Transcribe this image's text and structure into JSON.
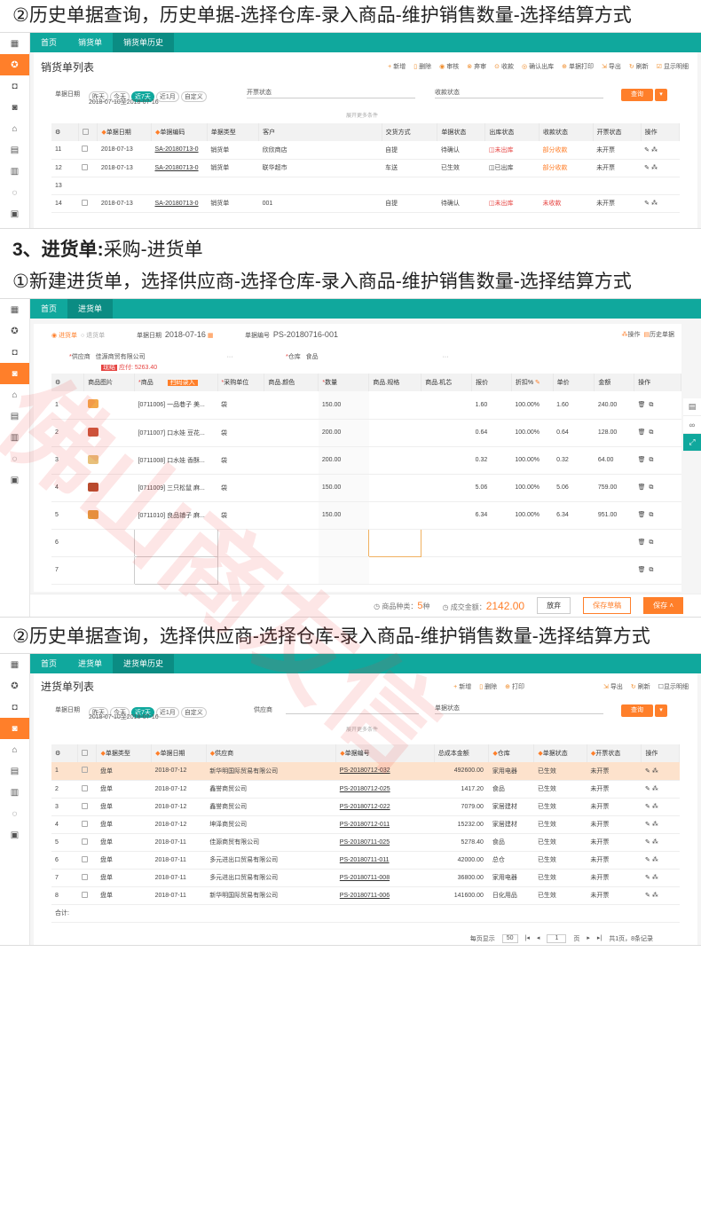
{
  "h1": "②历史单据查询，历史单据-选择仓库-录入商品-维护销售数量-选择结算方式",
  "h2_bold": "3、进货单:",
  "h2_rest": "采购-进货单",
  "h3": "①新建进货单，选择供应商-选择仓库-录入商品-维护销售数量-选择结算方式",
  "h4": "②历史单据查询，选择供应商-选择仓库-录入商品-维护销售数量-选择结算方式",
  "s1": {
    "tabs": [
      "首页",
      "销货单",
      "销货单历史"
    ],
    "title": "销货单列表",
    "toolbar": [
      "新增",
      "删除",
      "审核",
      "弃审",
      "收款",
      "确认出库",
      "单据打印",
      "导出",
      "刷新",
      "显示明细"
    ],
    "date_label": "单据日期",
    "chips": [
      "昨天",
      "今天",
      "近7天",
      "近1月",
      "自定义"
    ],
    "date_range": "2018-07-10至2018-07-16",
    "f2": "开票状态",
    "f3": "收款状态",
    "query": "查询",
    "more": "展开更多条件",
    "headers": [
      "",
      "",
      "单据日期",
      "单据编码",
      "单据类型",
      "客户",
      "交货方式",
      "单据状态",
      "出库状态",
      "收款状态",
      "开票状态",
      "操作"
    ],
    "rows": [
      {
        "n": "11",
        "d": "2018-07-13",
        "c": "SA-20180713-0",
        "t": "销货单",
        "cu": "欣欣商店",
        "m": "自提",
        "s": "待确认",
        "o": "未出库",
        "p": "部分收款",
        "i": "未开票"
      },
      {
        "n": "12",
        "d": "2018-07-13",
        "c": "SA-20180713-0",
        "t": "销货单",
        "cu": "联华超市",
        "m": "车送",
        "s": "已生效",
        "o": "已出库",
        "p": "部分收款",
        "i": "未开票"
      },
      {
        "n": "13",
        "d": "",
        "c": "",
        "t": "",
        "cu": "",
        "m": "",
        "s": "",
        "o": "",
        "p": "",
        "i": ""
      },
      {
        "n": "14",
        "d": "2018-07-13",
        "c": "SA-20180713-0",
        "t": "销货单",
        "cu": "001",
        "m": "自提",
        "s": "待确认",
        "o": "未出库",
        "p": "未收款",
        "i": "未开票"
      }
    ]
  },
  "s2": {
    "tabs": [
      "首页",
      "进货单"
    ],
    "radio1": "进货单",
    "radio2": "退货单",
    "date_label": "单据日期",
    "date_val": "2018-07-16",
    "no_label": "单据编号",
    "no_val": "PS-20180716-001",
    "ops": [
      "操作",
      "历史单据"
    ],
    "supplier_label": "供应商",
    "supplier_val": "佳源商贸有限公司",
    "wh_label": "仓库",
    "wh_val": "食品",
    "tag_now": "现结",
    "tag_pay": "应付: 5263.40",
    "scan": "扫码录入",
    "headers": [
      "",
      "商品图片",
      "商品",
      "采购单位",
      "商品.颜色",
      "数量",
      "商品.规格",
      "商品.机芯",
      "报价",
      "折扣%",
      "单价",
      "金额",
      "操作"
    ],
    "rows": [
      {
        "n": "1",
        "g": "[0711006] 一品巷子 美...",
        "u": "袋",
        "q": "150.00",
        "p": "1.60",
        "dc": "100.00%",
        "up": "1.60",
        "a": "240.00",
        "col": "#f3a94a"
      },
      {
        "n": "2",
        "g": "[0711007] 口水娃 豆花...",
        "u": "袋",
        "q": "200.00",
        "p": "0.64",
        "dc": "100.00%",
        "up": "0.64",
        "a": "128.00",
        "col": "#c9553b"
      },
      {
        "n": "3",
        "g": "[0711008] 口水娃 香酥...",
        "u": "袋",
        "q": "200.00",
        "p": "0.32",
        "dc": "100.00%",
        "up": "0.32",
        "a": "64.00",
        "col": "#e8c07a"
      },
      {
        "n": "4",
        "g": "[0711009] 三只松鼠 麻...",
        "u": "袋",
        "q": "150.00",
        "p": "5.06",
        "dc": "100.00%",
        "up": "5.06",
        "a": "759.00",
        "col": "#b84a2d"
      },
      {
        "n": "5",
        "g": "[0711010] 良品铺子 麻...",
        "u": "袋",
        "q": "150.00",
        "p": "6.34",
        "dc": "100.00%",
        "up": "6.34",
        "a": "951.00",
        "col": "#e59a3e"
      },
      {
        "n": "6",
        "g": "",
        "u": "",
        "q": "",
        "p": "",
        "dc": "",
        "up": "",
        "a": "",
        "col": ""
      },
      {
        "n": "7",
        "g": "",
        "u": "",
        "q": "",
        "p": "",
        "dc": "",
        "up": "",
        "a": "",
        "col": ""
      }
    ],
    "kinds_label": "商品种类：",
    "kinds_val": "5",
    "kinds_unit": "种",
    "amt_label": "成交金额：",
    "amt_val": "2142.00",
    "b1": "放弃",
    "b2": "保存草稿",
    "b3": "保存"
  },
  "s3": {
    "tabs": [
      "首页",
      "进货单",
      "进货单历史"
    ],
    "title": "进货单列表",
    "toolbar": [
      "新增",
      "删除",
      "打印",
      "导出",
      "刷新",
      "显示明细"
    ],
    "date_label": "单据日期",
    "chips": [
      "昨天",
      "今天",
      "近7天",
      "近1月",
      "自定义"
    ],
    "date_range": "2018-07-10至2018-07-16",
    "f2": "供应商",
    "f3": "单据状态",
    "query": "查询",
    "more": "展开更多条件",
    "headers": [
      "",
      "",
      "单据类型",
      "单据日期",
      "供应商",
      "单据编号",
      "总成本金额",
      "仓库",
      "单据状态",
      "开票状态",
      "操作"
    ],
    "rows": [
      {
        "n": "1",
        "t": "盘单",
        "d": "2018-07-12",
        "s": "新华明国际贸易有限公司",
        "c": "PS-20180712-032",
        "a": "492600.00",
        "w": "家用电器",
        "st": "已生效",
        "i": "未开票"
      },
      {
        "n": "2",
        "t": "盘单",
        "d": "2018-07-12",
        "s": "鑫誉商贸公司",
        "c": "PS-20180712-025",
        "a": "1417.20",
        "w": "食品",
        "st": "已生效",
        "i": "未开票"
      },
      {
        "n": "3",
        "t": "盘单",
        "d": "2018-07-12",
        "s": "鑫誉商贸公司",
        "c": "PS-20180712-022",
        "a": "7079.00",
        "w": "家居建材",
        "st": "已生效",
        "i": "未开票"
      },
      {
        "n": "4",
        "t": "盘单",
        "d": "2018-07-12",
        "s": "坤泽商贸公司",
        "c": "PS-20180712-011",
        "a": "15232.00",
        "w": "家居建材",
        "st": "已生效",
        "i": "未开票"
      },
      {
        "n": "5",
        "t": "盘单",
        "d": "2018-07-11",
        "s": "佳源商贸有限公司",
        "c": "PS-20180711-025",
        "a": "5278.40",
        "w": "食品",
        "st": "已生效",
        "i": "未开票"
      },
      {
        "n": "6",
        "t": "盘单",
        "d": "2018-07-11",
        "s": "多元进出口贸易有限公司",
        "c": "PS-20180711-011",
        "a": "42000.00",
        "w": "总仓",
        "st": "已生效",
        "i": "未开票"
      },
      {
        "n": "7",
        "t": "盘单",
        "d": "2018-07-11",
        "s": "多元进出口贸易有限公司",
        "c": "PS-20180711-008",
        "a": "36800.00",
        "w": "家用电器",
        "st": "已生效",
        "i": "未开票"
      },
      {
        "n": "8",
        "t": "盘单",
        "d": "2018-07-11",
        "s": "新华明国际贸易有限公司",
        "c": "PS-20180711-006",
        "a": "141600.00",
        "w": "日化用品",
        "st": "已生效",
        "i": "未开票"
      }
    ],
    "total": "合计:",
    "pager_per": "每页显示",
    "pager_size": "50",
    "pager_page": "1",
    "pager_of": "页",
    "pager_total": "共1页，8条记录"
  },
  "watermark": "佛山商友信"
}
